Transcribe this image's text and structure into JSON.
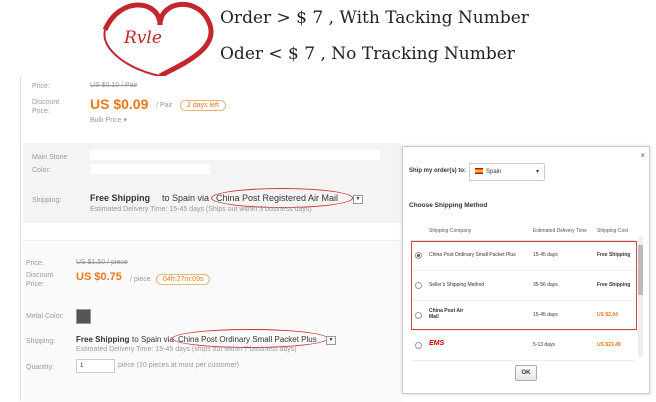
{
  "banner": {
    "logo_text": "Rvle",
    "line1": "Order > $ 7 , With Tacking Number",
    "line2": "Oder < $ 7 , No Tracking Number"
  },
  "product1": {
    "price_label": "Price:",
    "price_original": "US $0.10 / Pair",
    "discount_label": "Discount Price:",
    "discount_price": "US $0.09",
    "unit": "/ Pair",
    "time_left": "2 days left",
    "bulk_price": "Bulk Price",
    "main_stone_label": "Main Stone",
    "color_label": "Color:",
    "shipping_label": "Shipping:",
    "free_shipping": "Free Shipping",
    "to": "to Spain via",
    "method": "China Post Registered Air Mail",
    "delivery": "Estimated Delivery Time: 15-45 days (Ships out within 3 business days)"
  },
  "product2": {
    "price_label": "Price:",
    "price_original": "US $1.50 / piece",
    "discount_label": "Discount Price:",
    "discount_price": "US $0.75",
    "unit": "/ piece",
    "timer": "04h:27m:09s",
    "metal_color_label": "Metal Color:",
    "shipping_label": "Shipping:",
    "free_shipping": "Free Shipping",
    "to": "to Spain via",
    "method": "China Post Ordinary Small Packet Plus",
    "delivery": "Estimated Delivery Time: 15-45 days (ships out within 7 business days)",
    "quantity_label": "Quantity:",
    "quantity_value": "1",
    "quantity_note": "piece (10 pieces at most per customer)"
  },
  "panel": {
    "ship_to_label": "Ship my order(s) to:",
    "country": "Spain",
    "choose_title": "Choose Shipping Method",
    "headers": [
      "Shipping Company",
      "Estimated Delivery Time",
      "Shipping Cost"
    ],
    "rows": [
      {
        "company": "China Post Ordinary Small Packet Plus",
        "time": "15-45 days",
        "cost": "Free Shipping",
        "selected": true
      },
      {
        "company": "Seller's Shipping Method",
        "time": "35-56 days",
        "cost": "Free Shipping",
        "selected": false
      },
      {
        "company": "China Post Air Mail",
        "time": "15-45 days",
        "cost": "US $2.04",
        "selected": false
      },
      {
        "company": "EMS",
        "time": "5-13 days",
        "cost": "US $23.49",
        "selected": false
      }
    ],
    "ok_label": "OK",
    "close": "×"
  },
  "colors": {
    "accent": "#e8781a",
    "highlight": "#d24545"
  }
}
